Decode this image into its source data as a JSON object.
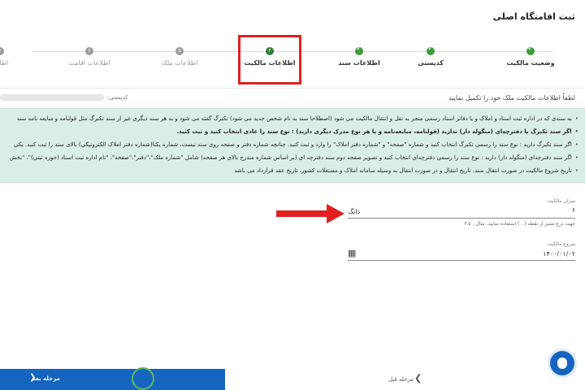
{
  "page": {
    "title": "ثبت اقامتگاه اصلی"
  },
  "stepper": {
    "steps": [
      {
        "label": "وضعیت مالکیت",
        "state": "done",
        "number": ""
      },
      {
        "label": "کدپستی",
        "state": "done",
        "number": ""
      },
      {
        "label": "اطلاعات سند",
        "state": "done",
        "number": ""
      },
      {
        "label": "اطلاعات مالکیت",
        "state": "active",
        "number": "۴"
      },
      {
        "label": "اطلاعات ملک",
        "state": "pending",
        "number": "۵"
      },
      {
        "label": "اطلاعات اقامت",
        "state": "pending",
        "number": "۶"
      },
      {
        "label": "اطلاعا",
        "state": "pending",
        "number": "۷"
      }
    ]
  },
  "form": {
    "intro": "لطفاً اطلاعات مالکیت ملک خود را تکمیل نمایید",
    "postal_code_label": "کدپستی:",
    "info_lines": [
      "به سندی که در اداره ثبت اسناد و املاک و یا دفاتر اسناد رسمی منجر به نقل و انتقال مالکیت می شود (اصطلاحا سند به نام شخص جدید می شود) تکبرگ گفته می شود و به هر سند دیگری غیر از سند تکبرگ مثل قولنامه و مبایعه نامه سند",
      "اگر سند تکبرگ یا دفترچه‌ای (منگوله دار) ندارید (قولنامه، مبایعه‌نامه و یا هر نوع مدرک دیگری دارید) : نوع سند را عادی انتخاب کنید و ثبت کنید.",
      "اگر سند تکبرگ دارید : نوع سند را رسمی تکبرگ انتخاب کنید و شماره \"صفحه\" و \"شماره دفتر املاک\" را وارد و ثبت کنید. چنانچه شماره دفتر و صفحه روی سند نیست، شماره یکتا(شماره دفتر املاک الکترونیکی) بالای سند را ثبت کنید. یکی",
      "اگر سند دفترچه‌ای (منگوله دار) دارید : نوع سند را رسمی دفترچه‌ای انتخاب کنید و تصویر صفحه دوم سند دفترچه ای (بر اساس شماره مندرج بالای هر صفحه) شامل \"شماره ملک\"،\"دفتر\"،\"صفحه\"، \"نام اداره ثبت اسناد (حوزه ثبتی)\"، \"بخش",
      "تاریخ شروع مالکیت در صورت انتقال سند، تاریخ انتقال و در صورت انتقال به وسیله سامانه املاک و مستغلات کشور، تاریخ عقد قرارداد می باشد"
    ],
    "ownership_amount": {
      "label": "میزان مالکیت",
      "value": "۶",
      "unit": "دانگ",
      "hint": "جهت درج ممیز از نقطه ( . ) استفاده نمایید. مثال : ۳.۵"
    },
    "ownership_start": {
      "label": "شروع مالکیت",
      "value": "۱۴۰۰/۰۱/۰۲"
    }
  },
  "nav": {
    "next_label": "مرحله بعد",
    "prev_label": "مرحله قبل"
  },
  "colors": {
    "primary": "#1565c0",
    "success": "#3a9d3a",
    "highlight": "#e02020",
    "info_bg": "#d9efe6"
  },
  "icons": {
    "calendar": "calendar-icon",
    "chevron_next": "chevron-left-icon",
    "chevron_prev": "chevron-right-icon",
    "help": "support-chat-icon",
    "arrow": "red-pointer-arrow"
  }
}
